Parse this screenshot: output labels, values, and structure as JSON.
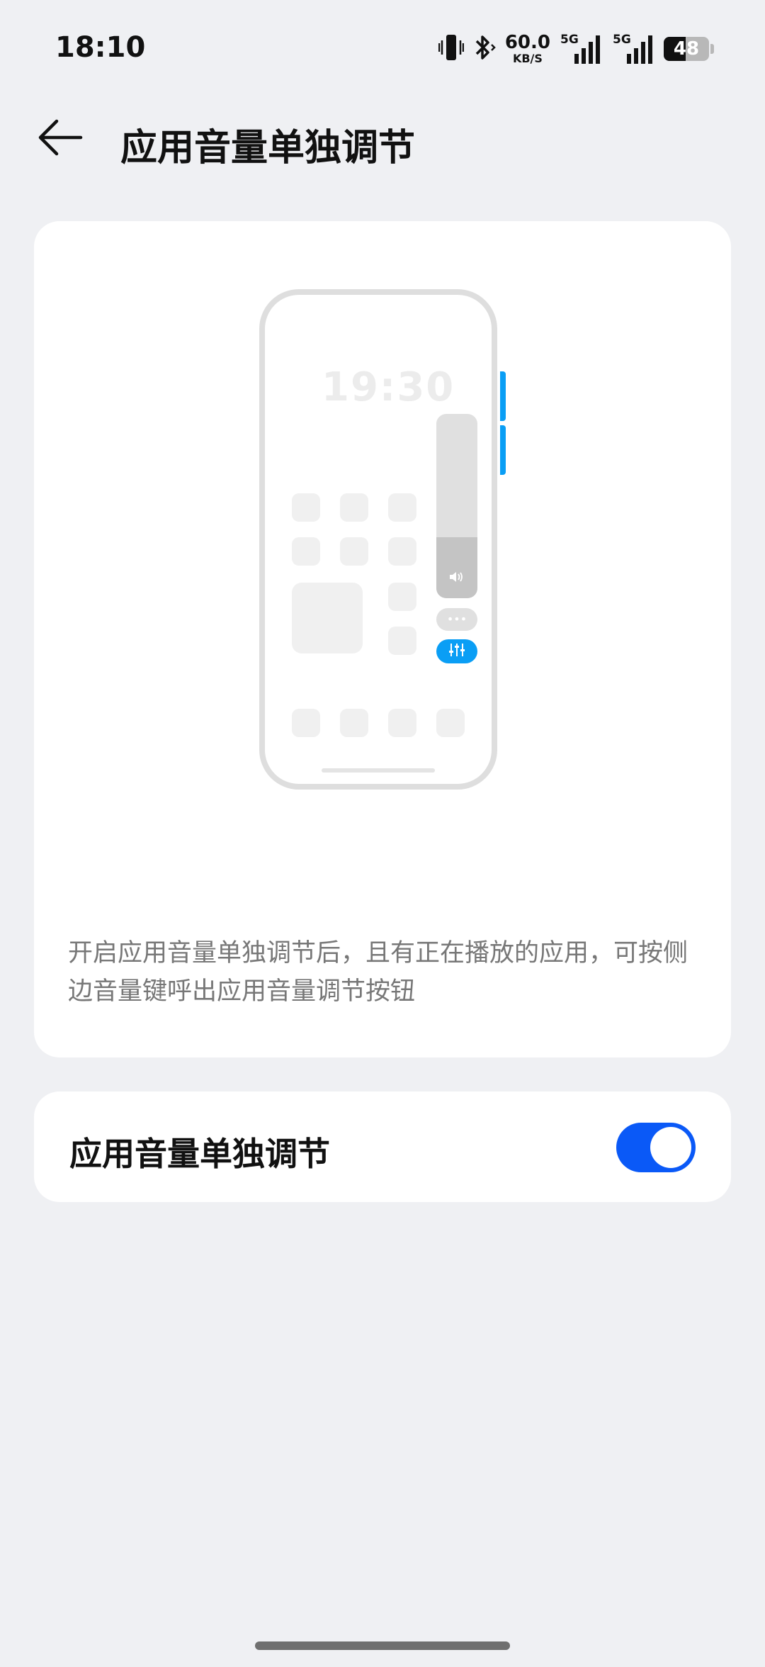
{
  "status_bar": {
    "time": "18:10",
    "net_speed_value": "60.0",
    "net_speed_unit": "KB/S",
    "signal1_label": "5G",
    "signal2_label": "5G",
    "battery": "48",
    "battery_level": 0.48,
    "icons": [
      "vibrate-icon",
      "bluetooth-icon",
      "signal-icon",
      "battery-icon"
    ]
  },
  "header": {
    "back_icon": "arrow-left-icon",
    "title": "应用音量单独调节"
  },
  "illustration": {
    "clock": "19:30",
    "accent_color": "#0a9ef5"
  },
  "description": "开启应用音量单独调节后，且有正在播放的应用，可按侧边音量键呼出应用音量调节按钮",
  "setting": {
    "label": "应用音量单独调节",
    "enabled": true,
    "toggle_color": "#0a59f7"
  }
}
